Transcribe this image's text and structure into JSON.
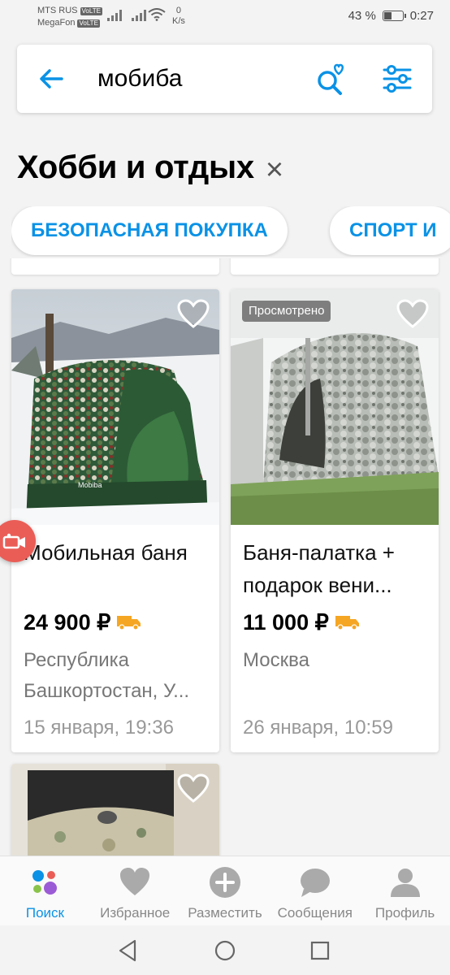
{
  "status_bar": {
    "carrier1": "MTS RUS",
    "carrier2": "MegaFon",
    "volte": "VoLTE",
    "net_speed_value": "0",
    "net_speed_unit": "K/s",
    "battery": "43 %",
    "time": "0:27"
  },
  "search": {
    "query": "мобиба",
    "back_icon": "arrow-left-icon",
    "saved_search_icon": "search-heart-icon",
    "filter_icon": "sliders-icon"
  },
  "category": {
    "title": "Хобби и отдых",
    "clear": "×"
  },
  "chips": [
    "БЕЗОПАСНАЯ ПОКУПКА",
    "СПОРТ И"
  ],
  "listings": [
    {
      "title": "Мобильная баня",
      "price": "24 900 ₽",
      "location": "Республика Башкортостан, У...",
      "date": "15 января, 19:36",
      "viewed": "",
      "delivery": true
    },
    {
      "title": "Баня-палатка + подарок вени...",
      "price": "11 000 ₽",
      "location": "Москва",
      "date": "26 января, 10:59",
      "viewed": "Просмотрено",
      "delivery": true
    }
  ],
  "nav": [
    {
      "label": "Поиск",
      "icon": "search-dots-icon",
      "active": true
    },
    {
      "label": "Избранное",
      "icon": "heart-icon",
      "active": false
    },
    {
      "label": "Разместить",
      "icon": "plus-circle-icon",
      "active": false
    },
    {
      "label": "Сообщения",
      "icon": "chat-bubble-icon",
      "active": false
    },
    {
      "label": "Профиль",
      "icon": "user-icon",
      "active": false
    }
  ],
  "colors": {
    "accent": "#0a92e6",
    "delivery": "#f5a623",
    "call_button": "#ea5d57",
    "background": "#f3f3f3"
  }
}
